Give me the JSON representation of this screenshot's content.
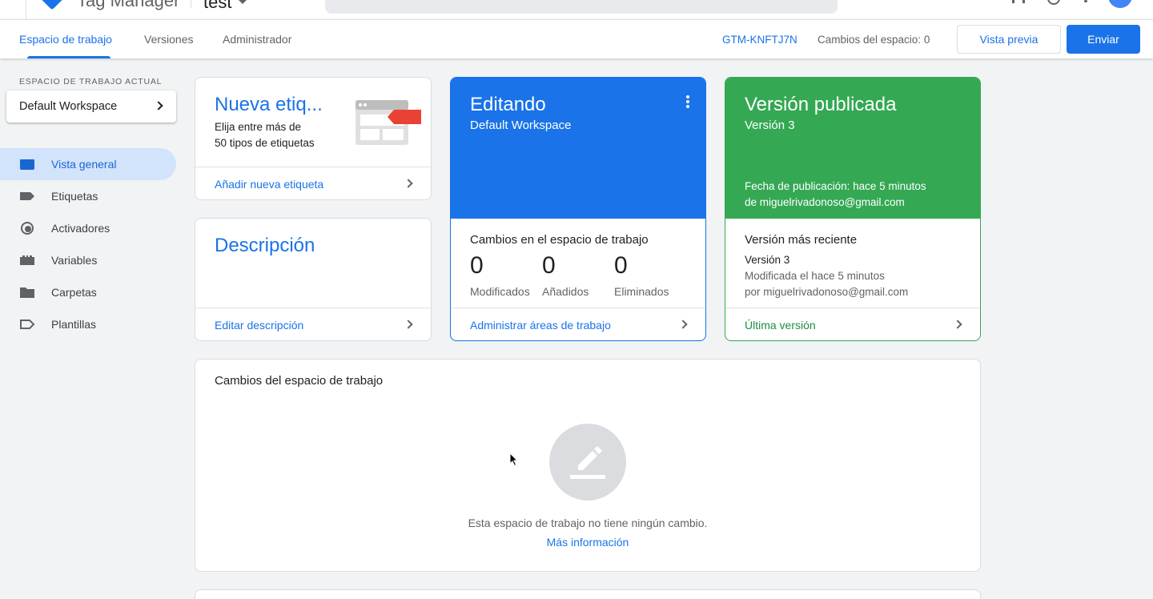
{
  "appbar": {
    "product_name": "Tag Manager",
    "container_name": "test"
  },
  "subnav": {
    "tabs": [
      {
        "label": "Espacio de trabajo",
        "active": true
      },
      {
        "label": "Versiones",
        "active": false
      },
      {
        "label": "Administrador",
        "active": false
      }
    ],
    "container_id": "GTM-KNFTJ7N",
    "workspace_changes": "Cambios del espacio: 0",
    "preview_label": "Vista previa",
    "submit_label": "Enviar"
  },
  "sidebar": {
    "workspace_label": "ESPACIO DE TRABAJO ACTUAL",
    "workspace_name": "Default Workspace",
    "items": [
      {
        "label": "Vista general",
        "icon": "overview-icon",
        "active": true
      },
      {
        "label": "Etiquetas",
        "icon": "tag-icon",
        "active": false
      },
      {
        "label": "Activadores",
        "icon": "trigger-icon",
        "active": false
      },
      {
        "label": "Variables",
        "icon": "variables-icon",
        "active": false
      },
      {
        "label": "Carpetas",
        "icon": "folder-icon",
        "active": false
      },
      {
        "label": "Plantillas",
        "icon": "template-icon",
        "active": false
      }
    ]
  },
  "cards": {
    "new_tag": {
      "title": "Nueva etiq...",
      "desc_line1": "Elija entre más de",
      "desc_line2": "50 tipos de etiquetas",
      "footer": "Añadir nueva etiqueta"
    },
    "description": {
      "title": "Descripción",
      "footer": "Editar descripción"
    },
    "editing": {
      "title": "Editando",
      "subtitle": "Default Workspace",
      "color": "#1a73e8",
      "section_title": "Cambios en el espacio de trabajo",
      "stats": [
        {
          "value": "0",
          "label": "Modificados"
        },
        {
          "value": "0",
          "label": "Añadidos"
        },
        {
          "value": "0",
          "label": "Eliminados"
        }
      ],
      "footer": "Administrar áreas de trabajo"
    },
    "published": {
      "title": "Versión publicada",
      "subtitle": "Versión 3",
      "color": "#34a853",
      "publish_date": "Fecha de publicación: hace 5 minutos",
      "publish_by": "de miguelrivadonoso@gmail.com",
      "section_title": "Versión más reciente",
      "latest_version": "Versión 3",
      "modified": "Modificada el hace 5 minutos",
      "modified_by": "por miguelrivadonoso@gmail.com",
      "footer": "Última versión"
    },
    "workspace_changes": {
      "title": "Cambios del espacio de trabajo",
      "empty_text": "Esta espacio de trabajo no tiene ningún cambio.",
      "link": "Más información"
    }
  }
}
